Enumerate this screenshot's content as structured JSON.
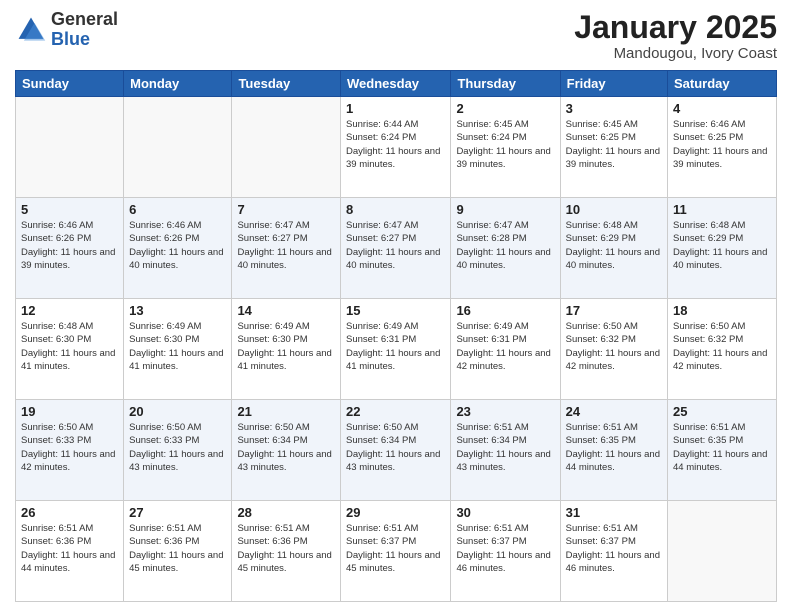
{
  "logo": {
    "general": "General",
    "blue": "Blue"
  },
  "header": {
    "month": "January 2025",
    "location": "Mandougou, Ivory Coast"
  },
  "weekdays": [
    "Sunday",
    "Monday",
    "Tuesday",
    "Wednesday",
    "Thursday",
    "Friday",
    "Saturday"
  ],
  "weeks": [
    [
      {
        "day": "",
        "info": ""
      },
      {
        "day": "",
        "info": ""
      },
      {
        "day": "",
        "info": ""
      },
      {
        "day": "1",
        "info": "Sunrise: 6:44 AM\nSunset: 6:24 PM\nDaylight: 11 hours and 39 minutes."
      },
      {
        "day": "2",
        "info": "Sunrise: 6:45 AM\nSunset: 6:24 PM\nDaylight: 11 hours and 39 minutes."
      },
      {
        "day": "3",
        "info": "Sunrise: 6:45 AM\nSunset: 6:25 PM\nDaylight: 11 hours and 39 minutes."
      },
      {
        "day": "4",
        "info": "Sunrise: 6:46 AM\nSunset: 6:25 PM\nDaylight: 11 hours and 39 minutes."
      }
    ],
    [
      {
        "day": "5",
        "info": "Sunrise: 6:46 AM\nSunset: 6:26 PM\nDaylight: 11 hours and 39 minutes."
      },
      {
        "day": "6",
        "info": "Sunrise: 6:46 AM\nSunset: 6:26 PM\nDaylight: 11 hours and 40 minutes."
      },
      {
        "day": "7",
        "info": "Sunrise: 6:47 AM\nSunset: 6:27 PM\nDaylight: 11 hours and 40 minutes."
      },
      {
        "day": "8",
        "info": "Sunrise: 6:47 AM\nSunset: 6:27 PM\nDaylight: 11 hours and 40 minutes."
      },
      {
        "day": "9",
        "info": "Sunrise: 6:47 AM\nSunset: 6:28 PM\nDaylight: 11 hours and 40 minutes."
      },
      {
        "day": "10",
        "info": "Sunrise: 6:48 AM\nSunset: 6:29 PM\nDaylight: 11 hours and 40 minutes."
      },
      {
        "day": "11",
        "info": "Sunrise: 6:48 AM\nSunset: 6:29 PM\nDaylight: 11 hours and 40 minutes."
      }
    ],
    [
      {
        "day": "12",
        "info": "Sunrise: 6:48 AM\nSunset: 6:30 PM\nDaylight: 11 hours and 41 minutes."
      },
      {
        "day": "13",
        "info": "Sunrise: 6:49 AM\nSunset: 6:30 PM\nDaylight: 11 hours and 41 minutes."
      },
      {
        "day": "14",
        "info": "Sunrise: 6:49 AM\nSunset: 6:30 PM\nDaylight: 11 hours and 41 minutes."
      },
      {
        "day": "15",
        "info": "Sunrise: 6:49 AM\nSunset: 6:31 PM\nDaylight: 11 hours and 41 minutes."
      },
      {
        "day": "16",
        "info": "Sunrise: 6:49 AM\nSunset: 6:31 PM\nDaylight: 11 hours and 42 minutes."
      },
      {
        "day": "17",
        "info": "Sunrise: 6:50 AM\nSunset: 6:32 PM\nDaylight: 11 hours and 42 minutes."
      },
      {
        "day": "18",
        "info": "Sunrise: 6:50 AM\nSunset: 6:32 PM\nDaylight: 11 hours and 42 minutes."
      }
    ],
    [
      {
        "day": "19",
        "info": "Sunrise: 6:50 AM\nSunset: 6:33 PM\nDaylight: 11 hours and 42 minutes."
      },
      {
        "day": "20",
        "info": "Sunrise: 6:50 AM\nSunset: 6:33 PM\nDaylight: 11 hours and 43 minutes."
      },
      {
        "day": "21",
        "info": "Sunrise: 6:50 AM\nSunset: 6:34 PM\nDaylight: 11 hours and 43 minutes."
      },
      {
        "day": "22",
        "info": "Sunrise: 6:50 AM\nSunset: 6:34 PM\nDaylight: 11 hours and 43 minutes."
      },
      {
        "day": "23",
        "info": "Sunrise: 6:51 AM\nSunset: 6:34 PM\nDaylight: 11 hours and 43 minutes."
      },
      {
        "day": "24",
        "info": "Sunrise: 6:51 AM\nSunset: 6:35 PM\nDaylight: 11 hours and 44 minutes."
      },
      {
        "day": "25",
        "info": "Sunrise: 6:51 AM\nSunset: 6:35 PM\nDaylight: 11 hours and 44 minutes."
      }
    ],
    [
      {
        "day": "26",
        "info": "Sunrise: 6:51 AM\nSunset: 6:36 PM\nDaylight: 11 hours and 44 minutes."
      },
      {
        "day": "27",
        "info": "Sunrise: 6:51 AM\nSunset: 6:36 PM\nDaylight: 11 hours and 45 minutes."
      },
      {
        "day": "28",
        "info": "Sunrise: 6:51 AM\nSunset: 6:36 PM\nDaylight: 11 hours and 45 minutes."
      },
      {
        "day": "29",
        "info": "Sunrise: 6:51 AM\nSunset: 6:37 PM\nDaylight: 11 hours and 45 minutes."
      },
      {
        "day": "30",
        "info": "Sunrise: 6:51 AM\nSunset: 6:37 PM\nDaylight: 11 hours and 46 minutes."
      },
      {
        "day": "31",
        "info": "Sunrise: 6:51 AM\nSunset: 6:37 PM\nDaylight: 11 hours and 46 minutes."
      },
      {
        "day": "",
        "info": ""
      }
    ]
  ]
}
